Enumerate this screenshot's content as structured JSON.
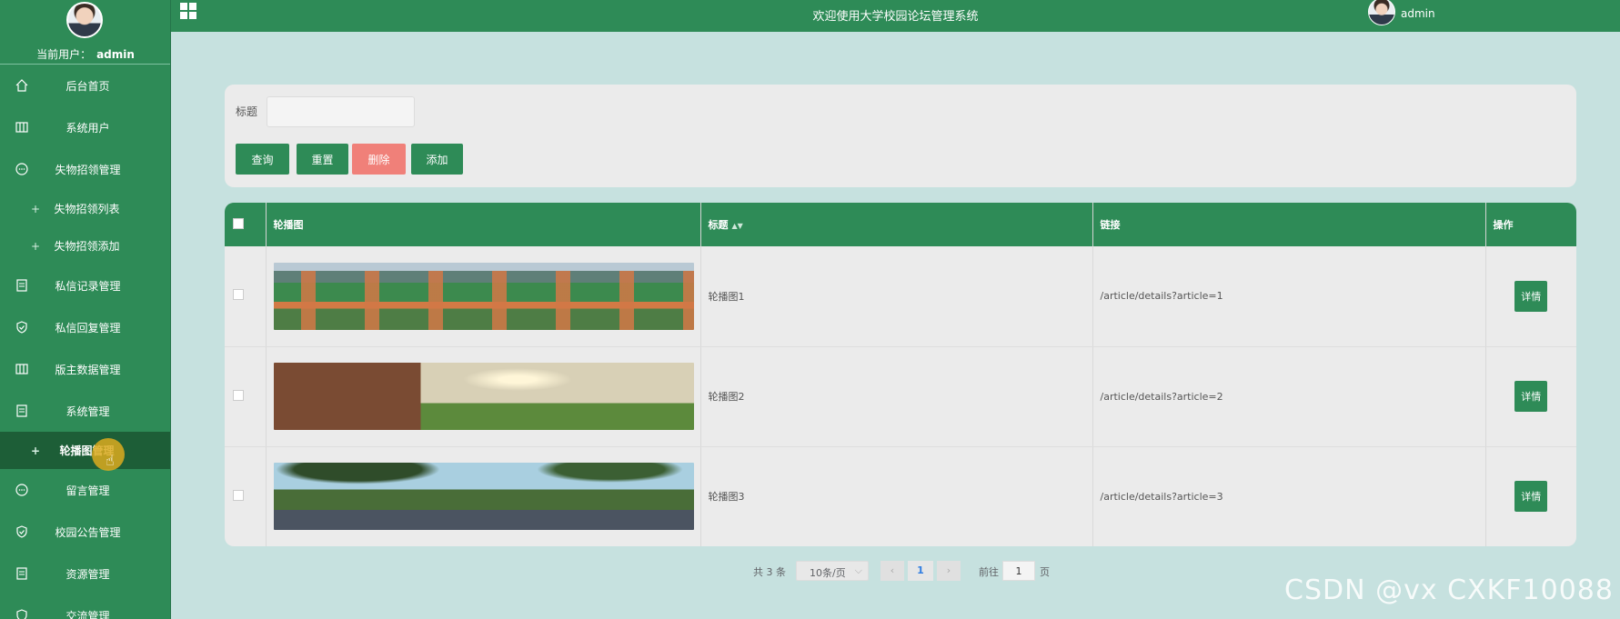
{
  "sidebar": {
    "current_user_label": "当前用户：",
    "current_user_name": "admin",
    "items": [
      {
        "label": "后台首页",
        "icon": "home-icon"
      },
      {
        "label": "系统用户",
        "icon": "columns-icon"
      },
      {
        "label": "失物招领管理",
        "icon": "chat-icon"
      },
      {
        "label": "失物招领列表",
        "sub": true
      },
      {
        "label": "失物招领添加",
        "sub": true
      },
      {
        "label": "私信记录管理",
        "icon": "document-icon"
      },
      {
        "label": "私信回复管理",
        "icon": "shield-check-icon"
      },
      {
        "label": "版主数据管理",
        "icon": "columns-icon"
      },
      {
        "label": "系统管理",
        "icon": "document-icon"
      },
      {
        "label": "轮播图管理",
        "sub": true,
        "active": true
      },
      {
        "label": "留言管理",
        "icon": "chat-icon"
      },
      {
        "label": "校园公告管理",
        "icon": "shield-check-icon"
      },
      {
        "label": "资源管理",
        "icon": "document-icon"
      },
      {
        "label": "交流管理",
        "icon": "shield-check-icon"
      }
    ]
  },
  "topbar": {
    "title": "欢迎使用大学校园论坛管理系统",
    "user": "admin"
  },
  "search": {
    "label": "标题",
    "value": "",
    "buttons": {
      "query": "查询",
      "reset": "重置",
      "delete": "删除",
      "add": "添加"
    }
  },
  "table": {
    "columns": [
      "轮播图",
      "标题",
      "链接",
      "操作"
    ],
    "rows": [
      {
        "title": "轮播图1",
        "link": "/article/details?article=1",
        "action": "详情"
      },
      {
        "title": "轮播图2",
        "link": "/article/details?article=2",
        "action": "详情"
      },
      {
        "title": "轮播图3",
        "link": "/article/details?article=3",
        "action": "详情"
      }
    ]
  },
  "pagination": {
    "total": "共 3 条",
    "page_size": "10条/页",
    "current_page": "1",
    "goto_label": "前往",
    "goto_value": "1",
    "page_suffix": "页"
  },
  "watermark": "CSDN @vx  CXKF10088",
  "colors": {
    "primary": "#2e8b57",
    "danger": "#f08079",
    "background": "#c6e1df",
    "active_menu": "#1d5e37"
  }
}
